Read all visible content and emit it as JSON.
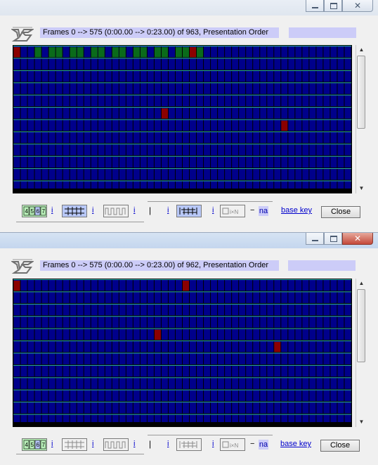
{
  "windows": [
    {
      "info_text": "Frames 0 --> 575 (0:00.00 --> 0:23.00) of 963,  Presentation Order",
      "title_buttons": {
        "minimize": "",
        "maximize": "",
        "close": "✕"
      },
      "grid": {
        "rows": 12,
        "cols": 48,
        "cell_color": "#00008b",
        "sep_color": "#2db4a8",
        "green_cells": [
          [
            0,
            3
          ],
          [
            0,
            5
          ],
          [
            0,
            6
          ],
          [
            0,
            8
          ],
          [
            0,
            9
          ],
          [
            0,
            11
          ],
          [
            0,
            12
          ],
          [
            0,
            14
          ],
          [
            0,
            15
          ],
          [
            0,
            17
          ],
          [
            0,
            18
          ],
          [
            0,
            20
          ],
          [
            0,
            21
          ],
          [
            0,
            23
          ],
          [
            0,
            24
          ],
          [
            0,
            26
          ]
        ],
        "red_cells": [
          [
            0,
            0
          ],
          [
            0,
            25
          ],
          [
            5,
            21
          ],
          [
            6,
            38
          ]
        ]
      },
      "toolbar": {
        "i1": "i",
        "i2": "i",
        "i3": "i",
        "i4": "i",
        "i5": "i",
        "pipe": "|",
        "dash": "−",
        "na": "na",
        "base_key": "base key",
        "close": "Close"
      },
      "toolbar_state": {
        "icon1_active": true,
        "icon2_active": true,
        "icon3_active": false,
        "icon4_active": true,
        "icon5_active": false
      }
    },
    {
      "info_text": "Frames 0 --> 575 (0:00.00 --> 0:23.00) of 962,  Presentation Order",
      "title_buttons": {
        "minimize": "",
        "maximize": "",
        "close": "✕"
      },
      "grid": {
        "rows": 12,
        "cols": 48,
        "cell_color": "#00008b",
        "sep_color": "#2db4a8",
        "green_cells": [],
        "red_cells": [
          [
            0,
            0
          ],
          [
            0,
            24
          ],
          [
            4,
            20
          ],
          [
            5,
            37
          ]
        ]
      },
      "toolbar": {
        "i1": "i",
        "i2": "i",
        "i3": "i",
        "i4": "i",
        "i5": "i",
        "pipe": "|",
        "dash": "−",
        "na": "na",
        "base_key": "base key",
        "close": "Close"
      },
      "toolbar_state": {
        "icon1_active": true,
        "icon2_active": false,
        "icon3_active": false,
        "icon4_active": false,
        "icon5_active": false
      }
    }
  ],
  "icons": {
    "logo": "virtualdub-logo-icon",
    "pulldown_pattern": "pulldown-4567-icon",
    "field_match": "field-match-icon",
    "waveform": "comb-waveform-icon",
    "field_swap": "field-swap-icon",
    "decimate": "decimate-ixn-icon"
  }
}
